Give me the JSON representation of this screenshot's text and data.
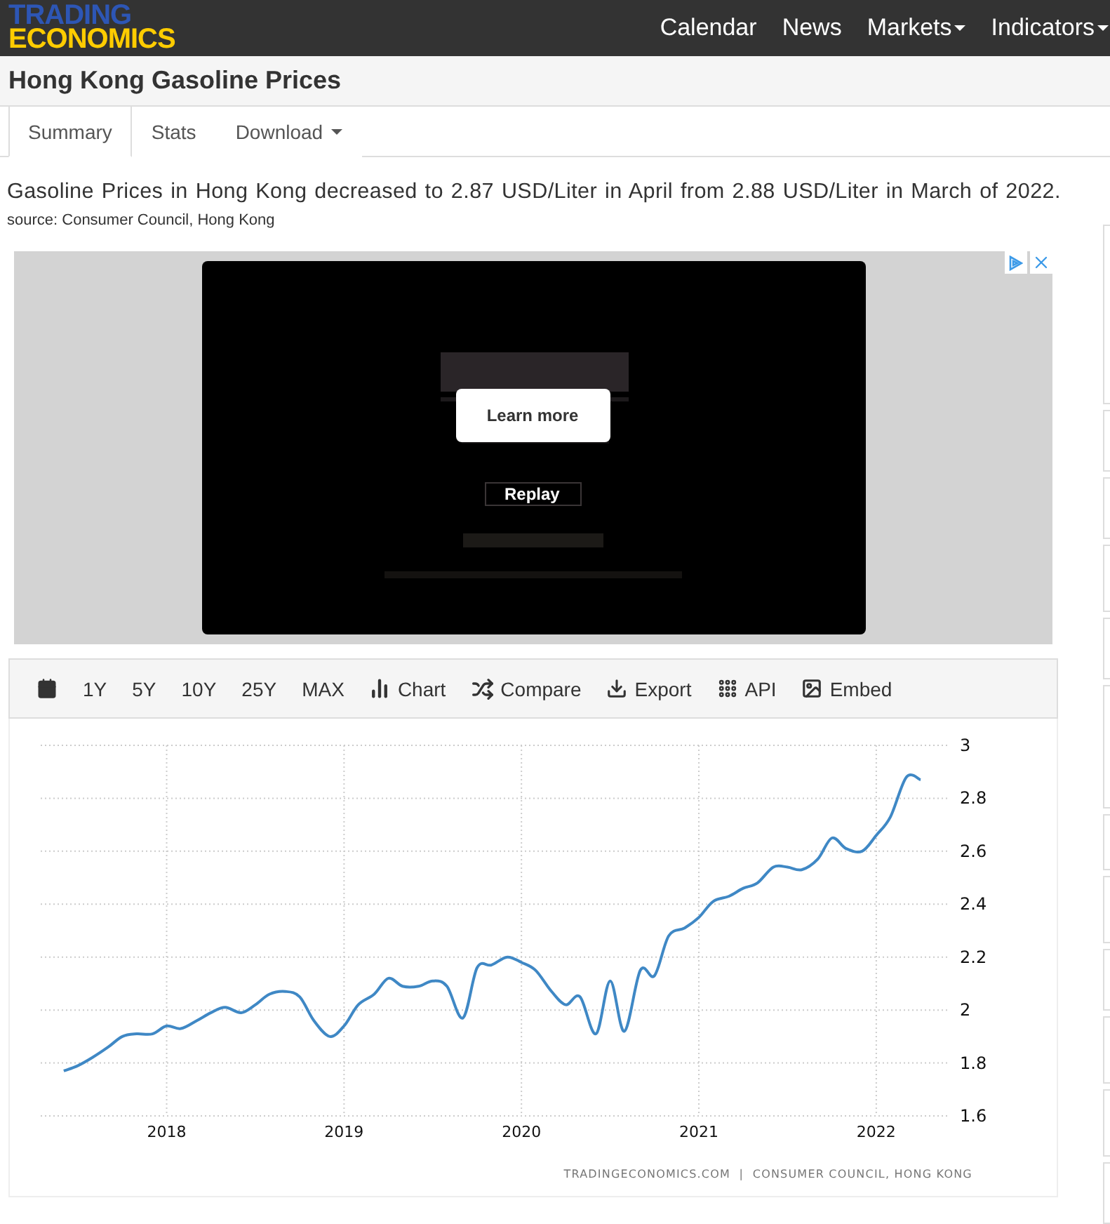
{
  "header": {
    "logo_top": "TRADING",
    "logo_bottom": "ECONOMICS",
    "nav": [
      {
        "label": "Calendar",
        "dropdown": false
      },
      {
        "label": "News",
        "dropdown": false
      },
      {
        "label": "Markets",
        "dropdown": true
      },
      {
        "label": "Indicators",
        "dropdown": true
      }
    ]
  },
  "title": "Hong Kong Gasoline Prices",
  "tabs": [
    {
      "label": "Summary",
      "selected": true,
      "dropdown": false
    },
    {
      "label": "Stats",
      "selected": false,
      "dropdown": false
    },
    {
      "label": "Download",
      "selected": false,
      "dropdown": true
    }
  ],
  "summary": "Gasoline Prices in Hong Kong decreased to 2.87 USD/Liter in April from 2.88 USD/Liter in March of 2022.",
  "source": "source: Consumer Council, Hong Kong",
  "ad": {
    "learn_more": "Learn more",
    "replay": "Replay"
  },
  "toolbar": [
    {
      "kind": "calendar"
    },
    {
      "kind": "range",
      "label": "1Y"
    },
    {
      "kind": "range",
      "label": "5Y"
    },
    {
      "kind": "range",
      "label": "10Y"
    },
    {
      "kind": "range",
      "label": "25Y"
    },
    {
      "kind": "range",
      "label": "MAX"
    },
    {
      "kind": "chart",
      "label": "Chart"
    },
    {
      "kind": "compare",
      "label": "Compare"
    },
    {
      "kind": "export",
      "label": "Export"
    },
    {
      "kind": "api",
      "label": "API"
    },
    {
      "kind": "embed",
      "label": "Embed"
    }
  ],
  "chart": {
    "credit": "TRADINGECONOMICS.COM  |  CONSUMER COUNCIL, HONG KONG",
    "chart_data": {
      "type": "line",
      "x": [
        2017.42,
        2017.5,
        2017.58,
        2017.67,
        2017.75,
        2017.83,
        2017.92,
        2018.0,
        2018.08,
        2018.17,
        2018.25,
        2018.33,
        2018.42,
        2018.5,
        2018.58,
        2018.67,
        2018.75,
        2018.83,
        2018.92,
        2019.0,
        2019.08,
        2019.17,
        2019.25,
        2019.33,
        2019.42,
        2019.5,
        2019.58,
        2019.67,
        2019.75,
        2019.83,
        2019.92,
        2020.0,
        2020.08,
        2020.17,
        2020.25,
        2020.33,
        2020.42,
        2020.5,
        2020.58,
        2020.67,
        2020.75,
        2020.83,
        2020.92,
        2021.0,
        2021.08,
        2021.17,
        2021.25,
        2021.33,
        2021.42,
        2021.5,
        2021.58,
        2021.67,
        2021.75,
        2021.83,
        2021.92,
        2022.0,
        2022.08,
        2022.17,
        2022.25
      ],
      "series": [
        {
          "color": "#3f88c5",
          "values": [
            1.77,
            1.79,
            1.82,
            1.86,
            1.9,
            1.91,
            1.91,
            1.94,
            1.93,
            1.96,
            1.99,
            2.01,
            1.99,
            2.02,
            2.06,
            2.07,
            2.05,
            1.96,
            1.9,
            1.94,
            2.02,
            2.06,
            2.12,
            2.09,
            2.09,
            2.11,
            2.09,
            1.97,
            2.16,
            2.17,
            2.2,
            2.18,
            2.15,
            2.07,
            2.02,
            2.05,
            1.91,
            2.11,
            1.92,
            2.15,
            2.13,
            2.28,
            2.31,
            2.35,
            2.41,
            2.43,
            2.46,
            2.48,
            2.54,
            2.54,
            2.53,
            2.57,
            2.65,
            2.61,
            2.6,
            2.66,
            2.73,
            2.88,
            2.87
          ]
        }
      ],
      "grid": true,
      "xlim": [
        2017.29,
        2022.4
      ],
      "ylim": [
        1.6,
        3
      ],
      "xticks": [
        {
          "value": 2018,
          "label": "2018"
        },
        {
          "value": 2019,
          "label": "2019"
        },
        {
          "value": 2020,
          "label": "2020"
        },
        {
          "value": 2021,
          "label": "2021"
        },
        {
          "value": 2022,
          "label": "2022"
        }
      ],
      "yticks": [
        {
          "value": 1.6,
          "label": "1.6"
        },
        {
          "value": 1.8,
          "label": "1.8"
        },
        {
          "value": 2,
          "label": "2"
        },
        {
          "value": 2.2,
          "label": "2.2"
        },
        {
          "value": 2.4,
          "label": "2.4"
        },
        {
          "value": 2.6,
          "label": "2.6"
        },
        {
          "value": 2.8,
          "label": "2.8"
        },
        {
          "value": 3,
          "label": "3"
        }
      ]
    }
  }
}
